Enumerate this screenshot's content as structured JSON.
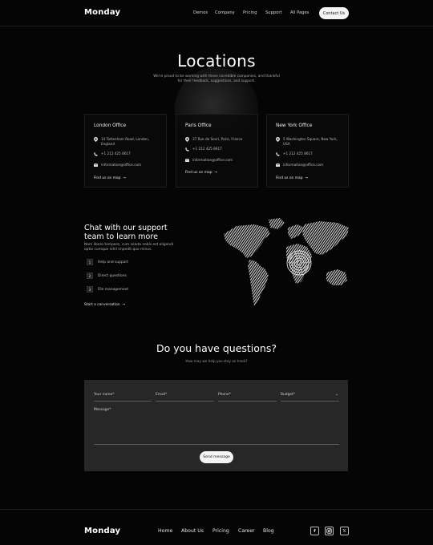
{
  "header": {
    "brand": "Monday",
    "nav": [
      "Demos",
      "Company",
      "Pricing",
      "Support",
      "All Pages"
    ],
    "contact_label": "Contact Us"
  },
  "hero": {
    "title": "Locations",
    "subtitle_line1": "We're proud to be working with these incredible companies, and thankful",
    "subtitle_line2": "for their feedback, suggestions, and support."
  },
  "offices": [
    {
      "title": "London Office",
      "address": "14 Tottenham Road, London, England",
      "phone": "+1 212 425 8617",
      "email": "information@office.com",
      "link": "Find us on map"
    },
    {
      "title": "Paris Office",
      "address": "37 Rue de Sevri, Paris, France",
      "phone": "+1 212 425 8617",
      "email": "information@office.com",
      "link": "Find us on map"
    },
    {
      "title": "New York Office",
      "address": "5 Washington Square, New York, USA",
      "phone": "+1 212 425 8617",
      "email": "information@office.com",
      "link": "Find us on map"
    }
  ],
  "chat": {
    "title_line1": "Chat with our support",
    "title_line2": "team to learn more",
    "text_line1": "Nam libero tempore, cum soluta nobis est eligendi",
    "text_line2": "optio cumque nihil impedit quo minus.",
    "steps": [
      {
        "num": "1",
        "label": "Help and support"
      },
      {
        "num": "2",
        "label": "Direct questions"
      },
      {
        "num": "3",
        "label": "File management"
      }
    ],
    "start_link": "Start a conversation"
  },
  "contact_form": {
    "title": "Do you have questions?",
    "subtitle": "How may we help you stay on track?",
    "name_label": "Your name*",
    "email_label": "Email*",
    "phone_label": "Phone*",
    "budget_label": "Budget*",
    "message_label": "Message*",
    "send_label": "Send message"
  },
  "footer": {
    "brand": "Monday",
    "nav": [
      "Home",
      "About Us",
      "Pricing",
      "Career",
      "Blog"
    ],
    "social_icons": [
      "facebook-icon",
      "instagram-icon",
      "x-icon"
    ]
  },
  "colors": {
    "background": "#050505",
    "form_background": "#272727",
    "button_background": "#f4f4f4"
  }
}
